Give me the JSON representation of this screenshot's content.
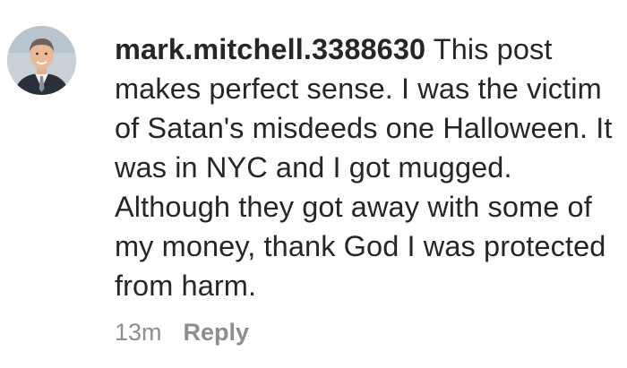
{
  "comment": {
    "username": "mark.mitchell.3388630",
    "text": "This post makes perfect sense. I was the victim of Satan's misdeeds one Halloween. It was in NYC and I got mugged. Although they got away with some of my money, thank God I was protected from harm.",
    "timestamp": "13m",
    "reply_label": "Reply",
    "avatar_icon": "profile-photo"
  }
}
